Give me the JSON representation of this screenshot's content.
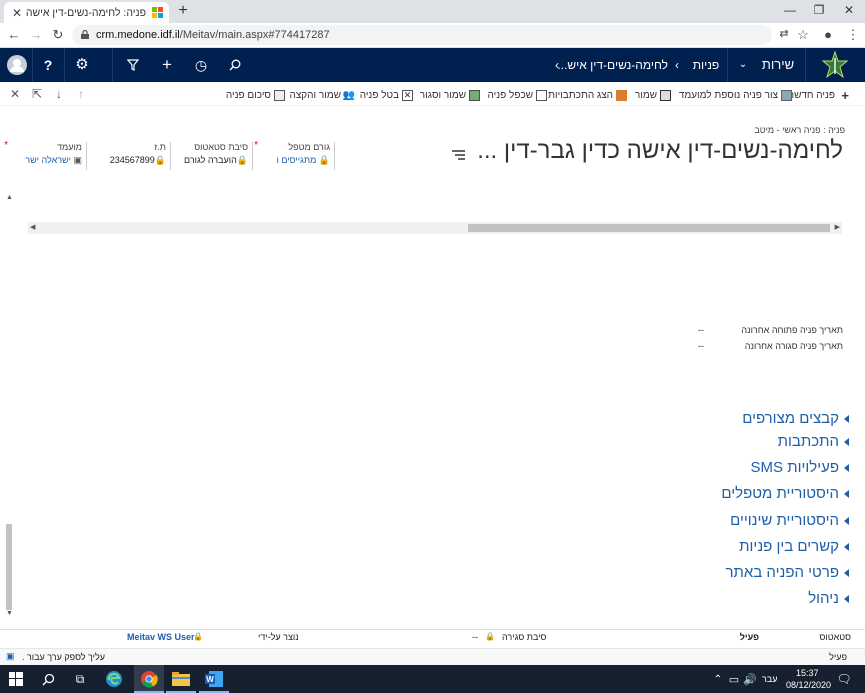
{
  "browser": {
    "tab_title": "פניה: לחימה-נשים-דין אישה כדין ג",
    "url_host": "crm.medone.idf.il",
    "url_path": "/Meitav/main.aspx#774417287"
  },
  "nav": {
    "service": "שירות",
    "cases": "פניות",
    "record": "לחימה-נשים-דין איש..."
  },
  "commands": [
    {
      "label": "פניה חדשה"
    },
    {
      "label": "צור פניה נוספת למועמד"
    },
    {
      "label": "שמור"
    },
    {
      "label": "הצג התכתבויות"
    },
    {
      "label": "שכפל פניה"
    },
    {
      "label": "שמור וסגור"
    },
    {
      "label": "בטל פניה"
    },
    {
      "label": "שמור והקצה"
    },
    {
      "label": "סיכום פניה"
    }
  ],
  "header": {
    "breadcrumb": "פניה : פניה ראשי - מיטב",
    "title": "לחימה-נשים-דין אישה כדין גבר-דין ...",
    "fields": {
      "handler_label": "גורם מטפל",
      "handler_value": "מתגייסים ו",
      "status_reason_label": "סיבת סטאטוס",
      "status_reason_value": "הועברה לגורם",
      "id_label": "ת.ז",
      "id_value": "234567899",
      "candidate_label": "מועמד",
      "candidate_value": "ישראלה ישר"
    }
  },
  "details": {
    "last_open_label": "תאריך פניה פתוחה אחרונה",
    "last_open_value": "--",
    "last_closed_label": "תאריך פניה סגורה אחרונה",
    "last_closed_value": "--"
  },
  "sections": [
    "קבצים מצורפים",
    "התכתבות",
    "פעילויות SMS",
    "היסטוריית מטפלים",
    "היסטוריית שינויים",
    "קשרים בין פניות",
    "פרטי הפניה באתר",
    "ניהול"
  ],
  "footer": {
    "status_label": "סטאטוס",
    "status_value": "פעיל",
    "close_reason_label": "סיבת סגירה",
    "close_reason_value": "--",
    "created_by_label": "נוצר על-ידי",
    "created_by_value": "Meitav WS User",
    "hint": "עליך לספק ערך עבור .",
    "state": "פעיל"
  },
  "taskbar": {
    "lang": "עבר",
    "time": "15:37",
    "date": "08/12/2020"
  },
  "colors": {
    "nav_bg": "#002050",
    "link": "#1e5fa8",
    "taskbar": "#17202e"
  }
}
